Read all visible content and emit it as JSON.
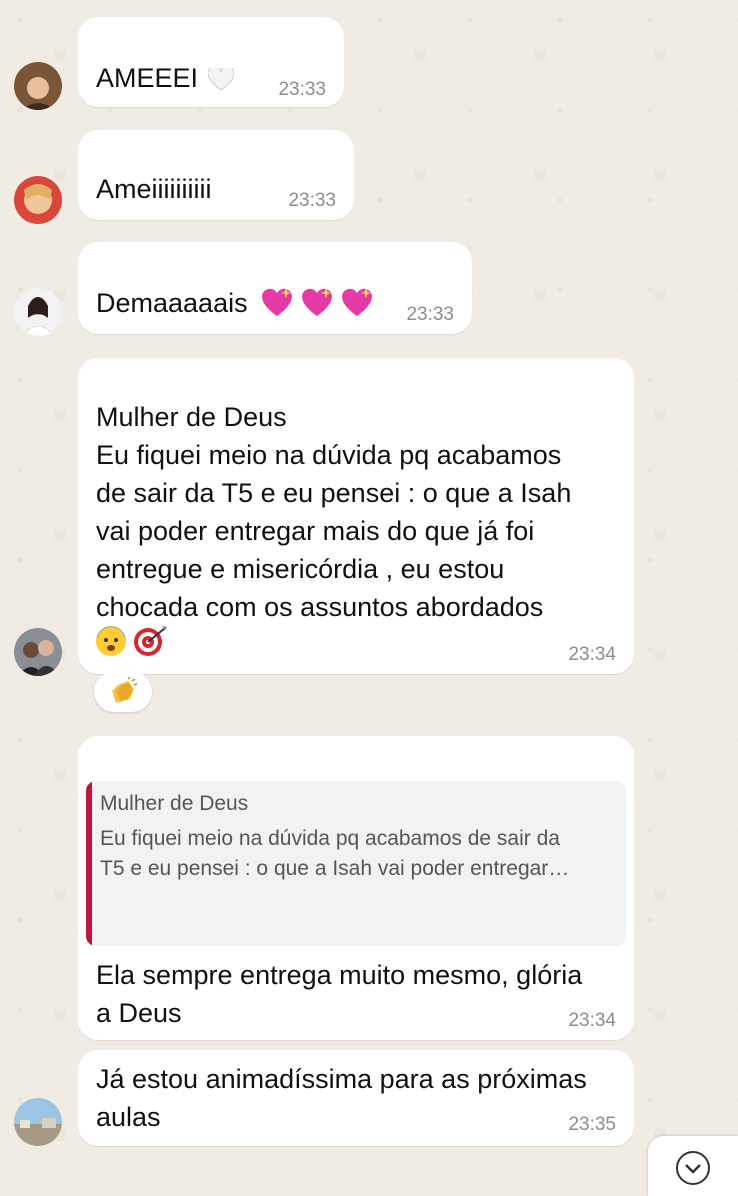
{
  "messages": [
    {
      "text": "AMEEEI",
      "time": "23:33",
      "icon": "white-heart-icon"
    },
    {
      "text": "Ameiiiiiiiiii",
      "time": "23:33"
    },
    {
      "text": "Demaaaaais",
      "time": "23:33",
      "icon": "sparkling-heart-icon"
    },
    {
      "text": "Mulher de Deus\nEu fiquei meio na dúvida pq acabamos\nde sair da T5 e eu pensei : o que a Isah\nvai poder entregar mais do que já foi\nentregue e misericórdia , eu estou\nchocada com os assuntos abordados",
      "time": "23:34",
      "reaction": "clapping-hands-icon"
    },
    {
      "quote_author": "Mulher de Deus",
      "quote_text": "Eu fiquei meio na dúvida pq acabamos de sair da\nT5 e eu pensei : o que a Isah vai poder entregar…",
      "text": "Ela sempre entrega muito mesmo, glória\na Deus",
      "time": "23:34"
    },
    {
      "text": "Já estou animadíssima para as próximas\naulas",
      "time": "23:35"
    }
  ],
  "colors": {
    "background": "#f0ebe3",
    "bubble": "#ffffff",
    "quote_bar": "#c0143c",
    "timestamp": "#8c8c8c"
  }
}
